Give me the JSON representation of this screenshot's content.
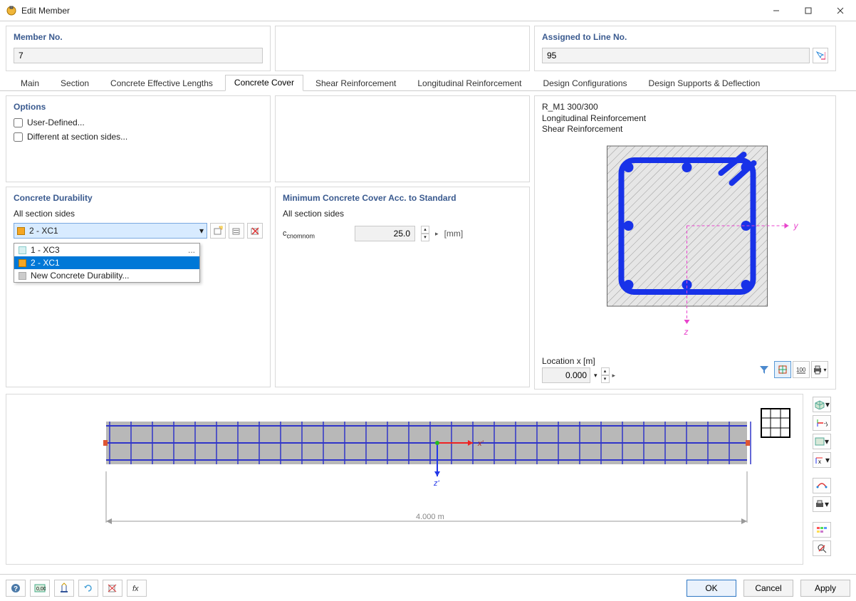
{
  "window": {
    "title": "Edit Member"
  },
  "header": {
    "member_label": "Member No.",
    "member_value": "7",
    "assigned_label": "Assigned to Line No.",
    "assigned_value": "95"
  },
  "tabs": [
    {
      "label": "Main",
      "active": false
    },
    {
      "label": "Section",
      "active": false
    },
    {
      "label": "Concrete Effective Lengths",
      "active": false
    },
    {
      "label": "Concrete Cover",
      "active": true
    },
    {
      "label": "Shear Reinforcement",
      "active": false
    },
    {
      "label": "Longitudinal Reinforcement",
      "active": false
    },
    {
      "label": "Design Configurations",
      "active": false
    },
    {
      "label": "Design Supports & Deflection",
      "active": false
    }
  ],
  "options": {
    "title": "Options",
    "user_defined": "User-Defined...",
    "different_sides": "Different at section sides..."
  },
  "durability": {
    "title": "Concrete Durability",
    "all_sides": "All section sides",
    "selected": "2 - XC1",
    "options": [
      {
        "label": "1 - XC3",
        "cls": "xc3",
        "dots": true
      },
      {
        "label": "2 - XC1",
        "cls": "xc1",
        "sel": true
      },
      {
        "label": "New Concrete Durability...",
        "cls": "dim"
      }
    ]
  },
  "cover": {
    "title": "Minimum Concrete Cover Acc. to Standard",
    "all_sides": "All section sides",
    "param": "cnom",
    "value": "25.0",
    "unit": "[mm]"
  },
  "preview": {
    "lines": [
      "R_M1 300/300",
      "Longitudinal Reinforcement",
      "Shear Reinforcement"
    ],
    "location_label": "Location x [m]",
    "location_value": "0.000"
  },
  "beam": {
    "length": "4.000 m",
    "z": "z'",
    "x": "x'"
  },
  "axes": {
    "y": "y",
    "z": "z"
  },
  "buttons": {
    "ok": "OK",
    "cancel": "Cancel",
    "apply": "Apply"
  }
}
